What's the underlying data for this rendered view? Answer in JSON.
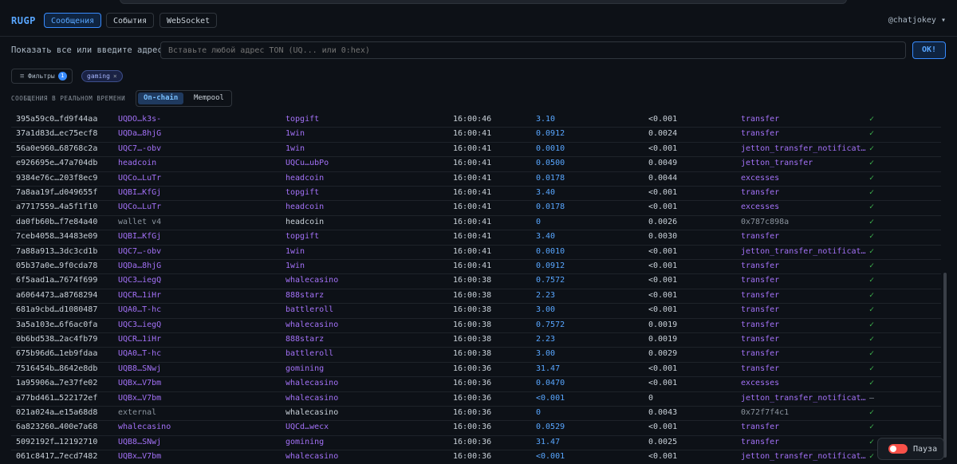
{
  "app": {
    "brand": "RUGP",
    "user": "@chatjokey ▾"
  },
  "nav": [
    {
      "label": "Сообщения",
      "active": true
    },
    {
      "label": "События",
      "active": false
    },
    {
      "label": "WebSocket",
      "active": false
    }
  ],
  "address": {
    "label": "Показать все или введите адрес:",
    "placeholder": "Вставьте любой адрес TON (UQ... или 0:hex)",
    "value": "",
    "ok": "OK!"
  },
  "filters": {
    "label": "Фильтры",
    "count": "1",
    "chip": "gaming",
    "chip_close": "×"
  },
  "section": {
    "label": "СООБЩЕНИЯ В РЕАЛЬНОМ ВРЕМЕНИ",
    "tabs": [
      "On-chain",
      "Mempool"
    ],
    "active_tab": "On-chain"
  },
  "rows": [
    {
      "hash": "395a59c0…fd9f44aa",
      "from": "UQDO…k3s-",
      "to": "topgift",
      "time": "16:00:46",
      "value": "3.10",
      "fee": "<0.001",
      "op": "transfer",
      "status": "✓"
    },
    {
      "hash": "37a1d83d…ec75ecf8",
      "from": "UQDa…8hjG",
      "to": "1win",
      "time": "16:00:41",
      "value": "0.0912",
      "fee": "0.0024",
      "op": "transfer",
      "status": "✓"
    },
    {
      "hash": "56a0e960…68768c2a",
      "from": "UQC7…-obv",
      "to": "1win",
      "time": "16:00:41",
      "value": "0.0010",
      "fee": "<0.001",
      "op": "jetton_transfer_notificat…",
      "status": "✓"
    },
    {
      "hash": "e926695e…47a704db",
      "from": "headcoin",
      "to": "UQCu…ubPo",
      "time": "16:00:41",
      "value": "0.0500",
      "fee": "0.0049",
      "op": "jetton_transfer",
      "status": "✓"
    },
    {
      "hash": "9384e76c…203f8ec9",
      "from": "UQCo…LuTr",
      "to": "headcoin",
      "time": "16:00:41",
      "value": "0.0178",
      "fee": "0.0044",
      "op": "excesses",
      "status": "✓"
    },
    {
      "hash": "7a8aa19f…d049655f",
      "from": "UQBI…KfGj",
      "to": "topgift",
      "time": "16:00:41",
      "value": "3.40",
      "fee": "<0.001",
      "op": "transfer",
      "status": "✓"
    },
    {
      "hash": "a7717559…4a5f1f10",
      "from": "UQCo…LuTr",
      "to": "headcoin",
      "time": "16:00:41",
      "value": "0.0178",
      "fee": "<0.001",
      "op": "excesses",
      "status": "✓"
    },
    {
      "hash": "da0fb60b…f7e84a40",
      "from": "wallet v4",
      "to": "headcoin",
      "time": "16:00:41",
      "value": "0",
      "fee": "0.0026",
      "op": "0x787c898a",
      "status": "✓",
      "from_plain": true,
      "to_plain": true,
      "op_muted": true
    },
    {
      "hash": "7ceb4058…34483e09",
      "from": "UQBI…KfGj",
      "to": "topgift",
      "time": "16:00:41",
      "value": "3.40",
      "fee": "0.0030",
      "op": "transfer",
      "status": "✓"
    },
    {
      "hash": "7a88a913…3dc3cd1b",
      "from": "UQC7…-obv",
      "to": "1win",
      "time": "16:00:41",
      "value": "0.0010",
      "fee": "<0.001",
      "op": "jetton_transfer_notificat…",
      "status": "✓"
    },
    {
      "hash": "05b37a0e…9f0cda78",
      "from": "UQDa…8hjG",
      "to": "1win",
      "time": "16:00:41",
      "value": "0.0912",
      "fee": "<0.001",
      "op": "transfer",
      "status": "✓"
    },
    {
      "hash": "6f5aad1a…7674f699",
      "from": "UQC3…iegQ",
      "to": "whalecasino",
      "time": "16:00:38",
      "value": "0.7572",
      "fee": "<0.001",
      "op": "transfer",
      "status": "✓"
    },
    {
      "hash": "a6064473…a8768294",
      "from": "UQCR…1iHr",
      "to": "888starz",
      "time": "16:00:38",
      "value": "2.23",
      "fee": "<0.001",
      "op": "transfer",
      "status": "✓"
    },
    {
      "hash": "681a9cbd…d1080487",
      "from": "UQA0…T-hc",
      "to": "battleroll",
      "time": "16:00:38",
      "value": "3.00",
      "fee": "<0.001",
      "op": "transfer",
      "status": "✓"
    },
    {
      "hash": "3a5a103e…6f6ac0fa",
      "from": "UQC3…iegQ",
      "to": "whalecasino",
      "time": "16:00:38",
      "value": "0.7572",
      "fee": "0.0019",
      "op": "transfer",
      "status": "✓"
    },
    {
      "hash": "0b6bd538…2ac4fb79",
      "from": "UQCR…1iHr",
      "to": "888starz",
      "time": "16:00:38",
      "value": "2.23",
      "fee": "0.0019",
      "op": "transfer",
      "status": "✓"
    },
    {
      "hash": "675b96d6…1eb9fdaa",
      "from": "UQA0…T-hc",
      "to": "battleroll",
      "time": "16:00:38",
      "value": "3.00",
      "fee": "0.0029",
      "op": "transfer",
      "status": "✓"
    },
    {
      "hash": "7516454b…8642e8db",
      "from": "UQB8…SNwj",
      "to": "gomining",
      "time": "16:00:36",
      "value": "31.47",
      "fee": "<0.001",
      "op": "transfer",
      "status": "✓"
    },
    {
      "hash": "1a95906a…7e37fe02",
      "from": "UQBx…V7bm",
      "to": "whalecasino",
      "time": "16:00:36",
      "value": "0.0470",
      "fee": "<0.001",
      "op": "excesses",
      "status": "✓"
    },
    {
      "hash": "a77bd461…522172ef",
      "from": "UQBx…V7bm",
      "to": "whalecasino",
      "time": "16:00:36",
      "value": "<0.001",
      "fee": "0",
      "op": "jetton_transfer_notificat…",
      "status": "–",
      "status_muted": true
    },
    {
      "hash": "021a024a…e15a68d8",
      "from": "external",
      "to": "whalecasino",
      "time": "16:00:36",
      "value": "0",
      "fee": "0.0043",
      "op": "0x72f7f4c1",
      "status": "✓",
      "from_muted": true,
      "to_plain": true,
      "op_muted": true
    },
    {
      "hash": "6a823260…400e7a68",
      "from": "whalecasino",
      "to": "UQCd…wecx",
      "time": "16:00:36",
      "value": "0.0529",
      "fee": "<0.001",
      "op": "transfer",
      "status": "✓"
    },
    {
      "hash": "5092192f…12192710",
      "from": "UQB8…SNwj",
      "to": "gomining",
      "time": "16:00:36",
      "value": "31.47",
      "fee": "0.0025",
      "op": "transfer",
      "status": "✓"
    },
    {
      "hash": "061c8417…7ecd7482",
      "from": "UQBx…V7bm",
      "to": "whalecasino",
      "time": "16:00:36",
      "value": "<0.001",
      "fee": "<0.001",
      "op": "jetton_transfer_notificat…",
      "status": "✓"
    }
  ],
  "pause": {
    "label": "Пауза",
    "enabled": true
  },
  "colors": {
    "accent": "#58a6ff",
    "purple": "#a371f7",
    "ok": "#3fb950",
    "toggle": "#f85149"
  }
}
